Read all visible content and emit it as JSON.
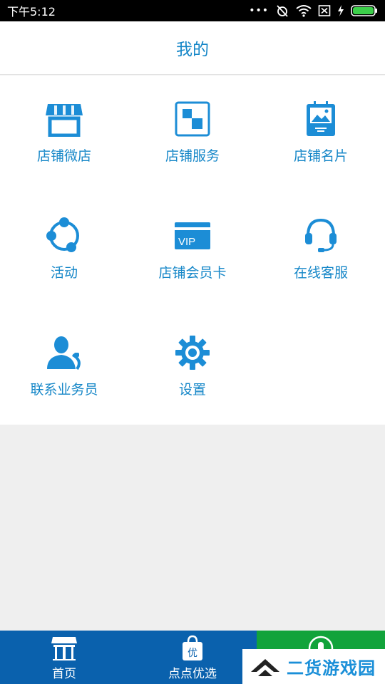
{
  "status": {
    "time": "下午5:12",
    "dots": "•••"
  },
  "header": {
    "title": "我的"
  },
  "menu": [
    {
      "label": "店铺微店",
      "icon": "store-icon"
    },
    {
      "label": "店铺服务",
      "icon": "service-icon"
    },
    {
      "label": "店铺名片",
      "icon": "business-card-icon"
    },
    {
      "label": "活动",
      "icon": "activity-icon"
    },
    {
      "label": "店铺会员卡",
      "icon": "vip-card-icon"
    },
    {
      "label": "在线客服",
      "icon": "headset-icon"
    },
    {
      "label": "联系业务员",
      "icon": "contact-salesman-icon"
    },
    {
      "label": "设置",
      "icon": "gear-icon"
    }
  ],
  "vip_text": "VIP",
  "tabs": [
    {
      "label": "首页",
      "icon": "shop-front-icon"
    },
    {
      "label": "点点优选",
      "icon": "shopping-bag-icon",
      "badge": "优"
    },
    {
      "label": "",
      "icon": "profile-icon"
    }
  ],
  "watermark": {
    "text": "二货游戏园"
  },
  "colors": {
    "accent": "#1687c8",
    "tabbar": "#0a61ad",
    "active_tab": "#12a33b"
  }
}
